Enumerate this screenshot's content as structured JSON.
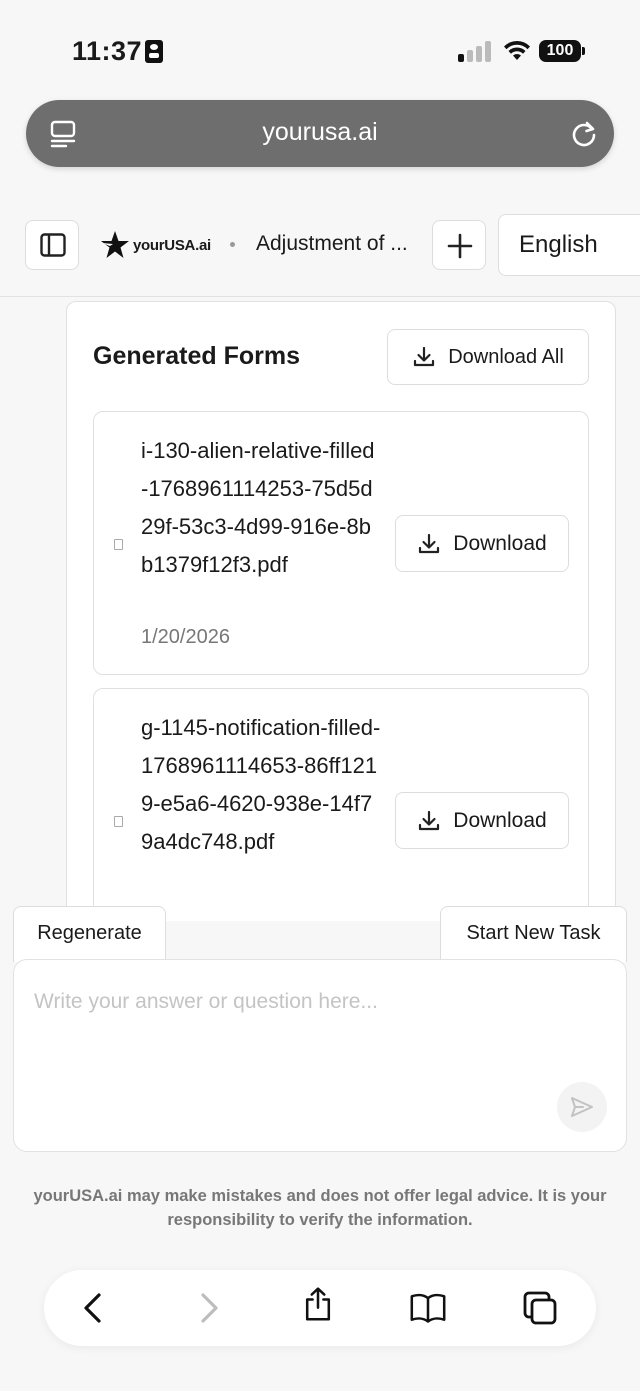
{
  "status_bar": {
    "time": "11:37",
    "battery": "100"
  },
  "browser": {
    "url": "yourusa.ai"
  },
  "header": {
    "logo_text": "yourUSA.ai",
    "conversation_title": "Adjustment of ...",
    "language": "English"
  },
  "forms": {
    "title": "Generated Forms",
    "download_all_label": "Download All",
    "items": [
      {
        "filename": "i-130-alien-relative-filled-1768961114253-75d5d29f-53c3-4d99-916e-8bb1379f12f3.pdf",
        "date": "1/20/2026",
        "download_label": "Download"
      },
      {
        "filename": "g-1145-notification-filled-1768961114653-86ff1219-e5a6-4620-938e-14f79a4dc748.pdf",
        "download_label": "Download"
      }
    ]
  },
  "actions": {
    "regenerate": "Regenerate",
    "start_new_task": "Start New Task"
  },
  "composer": {
    "placeholder": "Write your answer or question here..."
  },
  "disclaimer": "yourUSA.ai may make mistakes and does not offer legal advice. It is your responsibility to verify the information.",
  "icons": {
    "back": "chevron-left-icon",
    "forward": "chevron-right-icon",
    "share": "share-icon",
    "bookmarks": "book-icon",
    "tabs": "tabs-icon"
  }
}
